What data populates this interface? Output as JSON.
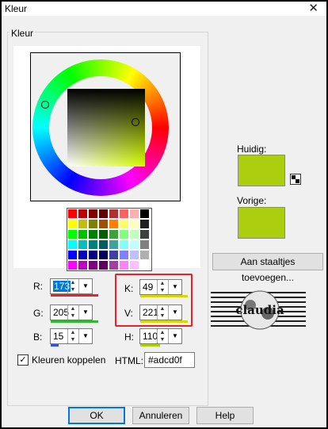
{
  "window": {
    "title": "Kleur",
    "close_glyph": "✕"
  },
  "group": {
    "label": "Kleur"
  },
  "palette": [
    [
      "#ff0000",
      "#c00000",
      "#800000",
      "#600000",
      "#b03030",
      "#ff6060",
      "#ffb0b0",
      "#000000"
    ],
    [
      "#ffff00",
      "#c0c000",
      "#808000",
      "#a05000",
      "#ff8000",
      "#ffff60",
      "#ffffc0",
      "#202020"
    ],
    [
      "#00ff00",
      "#00c000",
      "#008000",
      "#006000",
      "#40a040",
      "#80ff80",
      "#c0ffc0",
      "#404040"
    ],
    [
      "#00ffff",
      "#00c0c0",
      "#008080",
      "#006060",
      "#40a0a0",
      "#80ffff",
      "#c0ffff",
      "#808080"
    ],
    [
      "#0000ff",
      "#0000c0",
      "#000080",
      "#000060",
      "#4040a0",
      "#8080ff",
      "#c0c0ff",
      "#b0b0b0"
    ],
    [
      "#ff00ff",
      "#c000c0",
      "#800080",
      "#600060",
      "#a040a0",
      "#ff80ff",
      "#ffc0ff",
      "#ffffff"
    ]
  ],
  "fields": {
    "r": {
      "label": "R:",
      "value": "173",
      "bar": "#e3242b"
    },
    "g": {
      "label": "G:",
      "value": "205",
      "bar": "#2eb82e"
    },
    "b": {
      "label": "B:",
      "value": "15",
      "bar": "#2d55d6"
    },
    "k": {
      "label": "K:",
      "value": "49",
      "bar": "#d4d80a"
    },
    "v": {
      "label": "V:",
      "value": "221",
      "bar": "#d4d80a"
    },
    "h": {
      "label": "H:",
      "value": "110",
      "bar": "#adcd0f"
    }
  },
  "link_colors_label": "Kleuren koppelen",
  "link_colors_checked": "✓",
  "html": {
    "label": "HTML:",
    "value": "#adcd0f"
  },
  "current": {
    "label": "Huidig:",
    "color": "#adcd0f"
  },
  "previous": {
    "label": "Vorige:",
    "color": "#adcd0f"
  },
  "add_button": "Aan staaltjes toevoegen...",
  "logo_text": "claudia",
  "buttons": {
    "ok": "OK",
    "cancel": "Annuleren",
    "help": "Help"
  },
  "accent_highlight": "#e3242b"
}
